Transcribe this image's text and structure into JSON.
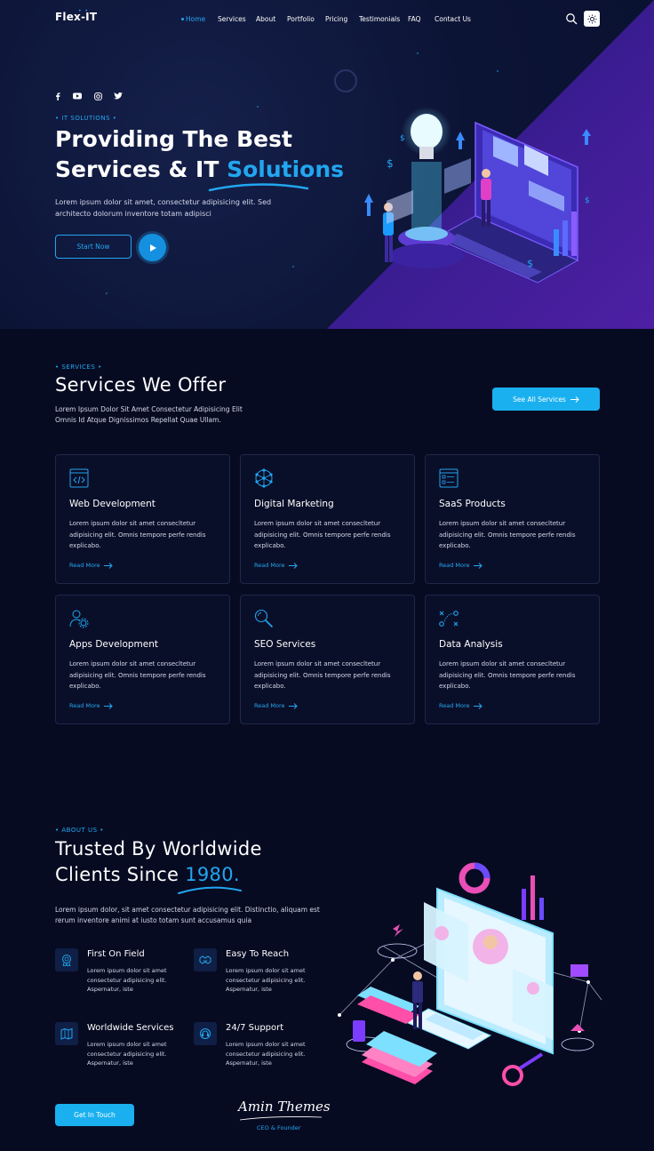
{
  "brand": {
    "name": "Flex-IT"
  },
  "nav": {
    "items": [
      "Home",
      "Services",
      "About",
      "Portfolio",
      "Pricing",
      "Testimonials",
      "FAQ",
      "Contact Us"
    ],
    "active": "Home"
  },
  "icons": {
    "search": "search-icon",
    "theme": "sun-icon",
    "social": [
      "facebook-icon",
      "youtube-icon",
      "instagram-icon",
      "twitter-icon"
    ]
  },
  "hero": {
    "eyebrow": "• IT SOLUTIONS •",
    "title_line1": "Providing The Best",
    "title_line2_pre": "Services & IT ",
    "title_line2_accent": "Solutions",
    "text": "Lorem ipsum dolor sit amet, consectetur adipisicing elit. Sed architecto dolorum inventore totam adipisci",
    "cta": "Start Now"
  },
  "services": {
    "eyebrow": "• SERVICES •",
    "title": "Services We Offer",
    "subtitle": "Lorem Ipsum Dolor Sit Amet Consectetur Adipisicing Elit Omnis Id Atque Dignissimos Repellat Quae Ullam.",
    "see_all": "See All Services",
    "cards": [
      {
        "title": "Web Development",
        "desc": "Lorem ipsum dolor sit amet consecltetur adipisicing elit. Omnis tempore perfe rendis explicabo.",
        "link": "Read More",
        "icon": "code-window-icon"
      },
      {
        "title": "Digital Marketing",
        "desc": "Lorem ipsum dolor sit amet consecltetur adipisicing elit. Omnis tempore perfe rendis explicabo.",
        "link": "Read More",
        "icon": "network-globe-icon"
      },
      {
        "title": "SaaS Products",
        "desc": "Lorem ipsum dolor sit amet consecltetur adipisicing elit. Omnis tempore perfe rendis explicabo.",
        "link": "Read More",
        "icon": "domain-browser-icon"
      },
      {
        "title": "Apps Development",
        "desc": "Lorem ipsum dolor sit amet consecltetur adipisicing elit. Omnis tempore perfe rendis explicabo.",
        "link": "Read More",
        "icon": "user-gear-icon"
      },
      {
        "title": "SEO Services",
        "desc": "Lorem ipsum dolor sit amet consecltetur adipisicing elit. Omnis tempore perfe rendis explicabo.",
        "link": "Read More",
        "icon": "magnifier-icon"
      },
      {
        "title": "Data Analysis",
        "desc": "Lorem ipsum dolor sit amet consecltetur adipisicing elit. Omnis tempore perfe rendis explicabo.",
        "link": "Read More",
        "icon": "strategy-xo-icon"
      }
    ]
  },
  "about": {
    "eyebrow": "• ABOUT US •",
    "title_line1": "Trusted By Worldwide",
    "title_line2_pre": "Clients Since ",
    "title_line2_accent": "1980.",
    "text": "Lorem ipsum dolor, sit amet consectetur adipisicing elit. Distinctio, aliquam est rerum inventore animi at iusto totam sunt accusamus quia",
    "features": [
      {
        "title": "First On Field",
        "desc": "Lorem ipsum dolor sit amet consectetur adipisicing elit. Aspernatur, iste",
        "icon": "award-badge-icon"
      },
      {
        "title": "Easy To Reach",
        "desc": "Lorem ipsum dolor sit amet consectetur adipisicing elit. Aspernatur, iste",
        "icon": "handshake-icon"
      },
      {
        "title": "Worldwide Services",
        "desc": "Lorem ipsum dolor sit amet consectetur adipisicing elit. Aspernatur, iste",
        "icon": "world-map-icon"
      },
      {
        "title": "24/7 Support",
        "desc": "Lorem ipsum dolor sit amet consectetur adipisicing elit. Aspernatur, iste",
        "icon": "support-icon"
      }
    ],
    "cta": "Get In Touch",
    "signature": "Amin Themes",
    "signature_role": "CEO & Founder"
  },
  "colors": {
    "accent": "#22a6f0",
    "background": "#070b22",
    "hero_purple": "#4b1fa8"
  }
}
